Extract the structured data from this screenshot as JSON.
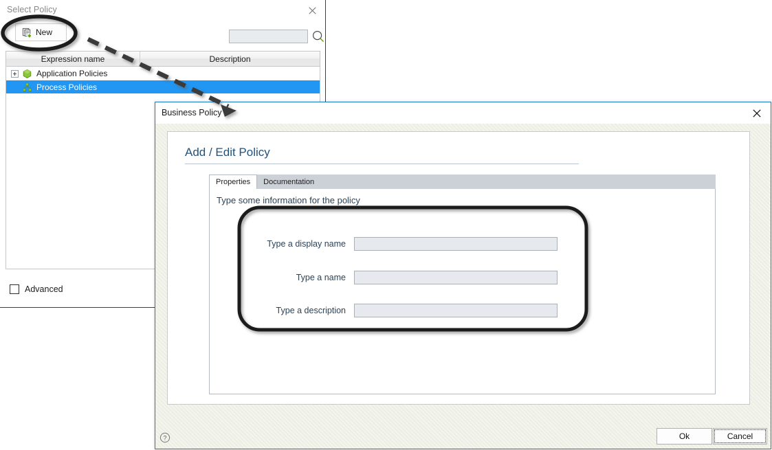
{
  "select_policy_window": {
    "title": "Select Policy",
    "close_icon": "close-icon",
    "toolbar": {
      "new_label": "New",
      "new_icon": "new-document-icon"
    },
    "search": {
      "value": "",
      "placeholder": "",
      "icon": "search-icon"
    },
    "table": {
      "columns": [
        "Expression name",
        "Description"
      ],
      "rows": [
        {
          "name": "Application Policies",
          "description": "",
          "icon": "green-hexagon-icon",
          "expandable": true,
          "selected": false
        },
        {
          "name": "Process Policies",
          "description": "",
          "icon": "green-hierarchy-icon",
          "expandable": false,
          "selected": true
        }
      ]
    },
    "advanced": {
      "label": "Advanced",
      "checked": false
    }
  },
  "business_policy_dialog": {
    "title": "Business Policy",
    "close_icon": "close-icon",
    "heading": "Add / Edit Policy",
    "tabs": [
      {
        "label": "Properties",
        "active": true
      },
      {
        "label": "Documentation",
        "active": false
      }
    ],
    "instruction": "Type some information for the policy",
    "fields": [
      {
        "label": "Type a display name",
        "value": "",
        "placeholder": ""
      },
      {
        "label": "Type a name",
        "value": "",
        "placeholder": ""
      },
      {
        "label": "Type a description",
        "value": "",
        "placeholder": ""
      }
    ],
    "help_icon": "help-question-icon",
    "buttons": {
      "ok_label": "Ok",
      "cancel_label": "Cancel"
    }
  },
  "annotations": {
    "highlight_oval": "oval-callout-around-new-button",
    "arrow": "dashed-arrow-from-new-button-to-business-policy-dialog",
    "field_group_box": "rounded-callout-around-policy-fields"
  },
  "colors": {
    "selection_blue": "#2196f3",
    "dialog_border_blue": "#1a7cc4",
    "heading_blue": "#23527c",
    "icon_green": "#7ab41d",
    "annotation_black": "#1f1f1f",
    "dialog_body": "#eceee3"
  }
}
